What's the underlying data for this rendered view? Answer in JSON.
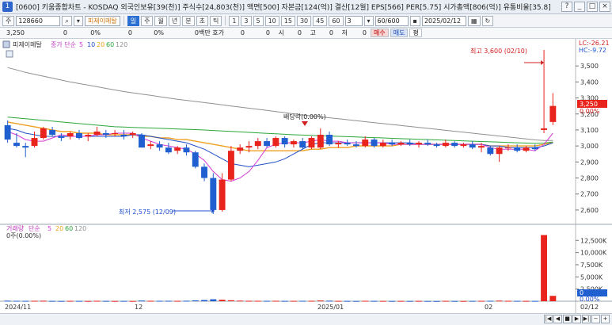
{
  "window": {
    "code": "[0600]",
    "title": "[0600] 키움종합차트 - KOSDAQ 외국인보유[39(천)] 주식수[24,803(천)] 액면[500] 자본금[124(억)] 결산[12월] EPS[566] PER[5.75] 시가총액[806(억)] 유통비율[35.8]",
    "buttons": [
      "?",
      "_",
      "□",
      "×"
    ]
  },
  "toolbar": {
    "period_btn": "주",
    "stock_code": "128660",
    "stock_name": "피제이메탈",
    "modes": [
      "일",
      "주",
      "월",
      "년",
      "분",
      "초",
      "틱"
    ],
    "active_mode": "일",
    "intervals": [
      "1",
      "3",
      "5",
      "10",
      "15",
      "30",
      "45",
      "60"
    ],
    "count_value": "3",
    "range_value": "60/600",
    "date_value": "2025/02/12"
  },
  "quote": {
    "price": "3,250",
    "cells": [
      "0",
      "0%",
      "0",
      "0%",
      "0백만 호가",
      "0",
      "0",
      "시",
      "0",
      "고",
      "0",
      "저",
      "0"
    ],
    "buy_label": "매수",
    "sell_label": "매도",
    "other_label": "평"
  },
  "price_panel": {
    "legend_name": "피제이메탈",
    "legend_ma": "종가 단순",
    "legend_periods": [
      "5",
      "10",
      "20",
      "60",
      "120"
    ],
    "lc_label": "LC:-26.21",
    "hc_label": "HC:-9.72",
    "current_price": "3,250",
    "current_change": "0.00%",
    "high_annotation": "최고 3,600 (02/10)",
    "low_annotation": "최저 2,575 (12/09)",
    "event_annotation": "배당락(0.00%)",
    "y_ticks": [
      "3,500",
      "3,400",
      "3,300",
      "3,200",
      "3,100",
      "3,000",
      "2,900",
      "2,800",
      "2,700",
      "2,600"
    ]
  },
  "volume_panel": {
    "legend_name": "거래량",
    "legend_ma": "단순",
    "legend_periods": [
      "5",
      "20",
      "60",
      "120"
    ],
    "subtitle": "0주(0.00%)",
    "current_value": "0",
    "current_change": "0.00%",
    "y_ticks": [
      "12,500K",
      "10,000K",
      "7,500K",
      "5,000K",
      "2,500K"
    ]
  },
  "x_axis": {
    "labels": [
      "2024/11",
      "12",
      "2025/01",
      "02"
    ],
    "end_label": "02/12"
  },
  "colors": {
    "up": "#e8241c",
    "down": "#1f5fd0",
    "ma5": "#d63cd6",
    "ma10": "#2050c8",
    "ma20": "#f0a020",
    "ma60": "#2aa83a",
    "ma120": "#909090"
  },
  "chart_data": {
    "type": "candlestick",
    "ylim": [
      2550,
      3600
    ],
    "candles": [
      {
        "o": 3130,
        "h": 3160,
        "l": 3020,
        "c": 3040
      },
      {
        "o": 3020,
        "h": 3080,
        "l": 2990,
        "c": 3000
      },
      {
        "o": 3000,
        "h": 3020,
        "l": 2930,
        "c": 2990
      },
      {
        "o": 3000,
        "h": 3090,
        "l": 2990,
        "c": 3050
      },
      {
        "o": 3050,
        "h": 3120,
        "l": 3040,
        "c": 3110
      },
      {
        "o": 3100,
        "h": 3120,
        "l": 3060,
        "c": 3070
      },
      {
        "o": 3060,
        "h": 3080,
        "l": 3030,
        "c": 3050
      },
      {
        "o": 3060,
        "h": 3090,
        "l": 3040,
        "c": 3080
      },
      {
        "o": 3080,
        "h": 3100,
        "l": 3040,
        "c": 3050
      },
      {
        "o": 3060,
        "h": 3080,
        "l": 3030,
        "c": 3070
      },
      {
        "o": 3070,
        "h": 3120,
        "l": 3060,
        "c": 3090
      },
      {
        "o": 3080,
        "h": 3100,
        "l": 3050,
        "c": 3070
      },
      {
        "o": 3080,
        "h": 3100,
        "l": 3060,
        "c": 3080
      },
      {
        "o": 3070,
        "h": 3100,
        "l": 3040,
        "c": 3060
      },
      {
        "o": 3070,
        "h": 3090,
        "l": 3050,
        "c": 3080
      },
      {
        "o": 3070,
        "h": 3080,
        "l": 2990,
        "c": 2990
      },
      {
        "o": 3000,
        "h": 3030,
        "l": 2980,
        "c": 3010
      },
      {
        "o": 3010,
        "h": 3030,
        "l": 2970,
        "c": 2990
      },
      {
        "o": 2990,
        "h": 3020,
        "l": 2950,
        "c": 2960
      },
      {
        "o": 2970,
        "h": 3000,
        "l": 2950,
        "c": 2990
      },
      {
        "o": 2990,
        "h": 3010,
        "l": 2940,
        "c": 2960
      },
      {
        "o": 2960,
        "h": 2970,
        "l": 2860,
        "c": 2870
      },
      {
        "o": 2870,
        "h": 2890,
        "l": 2780,
        "c": 2800
      },
      {
        "o": 2800,
        "h": 2830,
        "l": 2575,
        "c": 2600
      },
      {
        "o": 2600,
        "h": 2830,
        "l": 2590,
        "c": 2790
      },
      {
        "o": 2790,
        "h": 3000,
        "l": 2780,
        "c": 2970
      },
      {
        "o": 2970,
        "h": 3010,
        "l": 2950,
        "c": 2990
      },
      {
        "o": 2990,
        "h": 3030,
        "l": 2960,
        "c": 3000
      },
      {
        "o": 3000,
        "h": 3050,
        "l": 2980,
        "c": 3030
      },
      {
        "o": 3030,
        "h": 3050,
        "l": 2990,
        "c": 3000
      },
      {
        "o": 3000,
        "h": 3060,
        "l": 2990,
        "c": 3050
      },
      {
        "o": 3050,
        "h": 3060,
        "l": 2990,
        "c": 3010
      },
      {
        "o": 3010,
        "h": 3040,
        "l": 2990,
        "c": 3030
      },
      {
        "o": 3030,
        "h": 3050,
        "l": 2980,
        "c": 2990
      },
      {
        "o": 2990,
        "h": 3060,
        "l": 2980,
        "c": 3050
      },
      {
        "o": 2990,
        "h": 3110,
        "l": 2980,
        "c": 3070
      },
      {
        "o": 3070,
        "h": 3090,
        "l": 3000,
        "c": 3010
      },
      {
        "o": 3010,
        "h": 3030,
        "l": 2990,
        "c": 3020
      },
      {
        "o": 3020,
        "h": 3040,
        "l": 3000,
        "c": 3010
      },
      {
        "o": 3010,
        "h": 3030,
        "l": 2990,
        "c": 3000
      },
      {
        "o": 3000,
        "h": 3060,
        "l": 2990,
        "c": 3040
      },
      {
        "o": 3040,
        "h": 3050,
        "l": 2990,
        "c": 3000
      },
      {
        "o": 3000,
        "h": 3040,
        "l": 2990,
        "c": 3020
      },
      {
        "o": 3020,
        "h": 3040,
        "l": 3000,
        "c": 3010
      },
      {
        "o": 3010,
        "h": 3030,
        "l": 3000,
        "c": 3020
      },
      {
        "o": 3020,
        "h": 3040,
        "l": 3000,
        "c": 3010
      },
      {
        "o": 3010,
        "h": 3030,
        "l": 2990,
        "c": 3020
      },
      {
        "o": 3020,
        "h": 3040,
        "l": 3000,
        "c": 3010
      },
      {
        "o": 3010,
        "h": 3020,
        "l": 2990,
        "c": 3000
      },
      {
        "o": 3000,
        "h": 3040,
        "l": 2990,
        "c": 3020
      },
      {
        "o": 3020,
        "h": 3030,
        "l": 2990,
        "c": 3000
      },
      {
        "o": 3000,
        "h": 3020,
        "l": 2990,
        "c": 3010
      },
      {
        "o": 3010,
        "h": 3030,
        "l": 2980,
        "c": 2990
      },
      {
        "o": 2990,
        "h": 3020,
        "l": 2960,
        "c": 3000
      },
      {
        "o": 2990,
        "h": 3000,
        "l": 2940,
        "c": 2950
      },
      {
        "o": 2950,
        "h": 3000,
        "l": 2900,
        "c": 2990
      },
      {
        "o": 2990,
        "h": 3010,
        "l": 2970,
        "c": 2990
      },
      {
        "o": 2990,
        "h": 3010,
        "l": 2960,
        "c": 2970
      },
      {
        "o": 2970,
        "h": 3000,
        "l": 2960,
        "c": 2990
      },
      {
        "o": 2990,
        "h": 3010,
        "l": 2970,
        "c": 2980
      },
      {
        "o": 3100,
        "h": 3600,
        "l": 3080,
        "c": 3110
      },
      {
        "o": 3150,
        "h": 3330,
        "l": 3130,
        "c": 3250
      }
    ],
    "volume": [
      110,
      80,
      70,
      90,
      100,
      60,
      50,
      70,
      60,
      50,
      80,
      60,
      50,
      60,
      50,
      140,
      90,
      80,
      90,
      70,
      100,
      180,
      250,
      400,
      300,
      200,
      120,
      90,
      80,
      70,
      90,
      60,
      70,
      80,
      90,
      150,
      110,
      70,
      60,
      50,
      80,
      60,
      60,
      50,
      60,
      50,
      60,
      50,
      40,
      70,
      50,
      50,
      60,
      70,
      90,
      120,
      80,
      70,
      60,
      60,
      13600,
      1100
    ],
    "ma5": [
      3090,
      3070,
      3040,
      3030,
      3030,
      3050,
      3070,
      3060,
      3060,
      3060,
      3070,
      3070,
      3080,
      3080,
      3080,
      3050,
      3030,
      3010,
      3000,
      2990,
      2980,
      2950,
      2910,
      2840,
      2790,
      2780,
      2800,
      2840,
      2910,
      2990,
      3010,
      3020,
      3020,
      3020,
      3030,
      3040,
      3030,
      3030,
      3020,
      3020,
      3020,
      3020,
      3020,
      3010,
      3010,
      3010,
      3010,
      3010,
      3010,
      3010,
      3010,
      3010,
      3010,
      3010,
      2990,
      2980,
      2980,
      2980,
      2980,
      2970,
      3010,
      3080
    ],
    "ma10": [
      3110,
      3100,
      3080,
      3070,
      3060,
      3060,
      3060,
      3060,
      3060,
      3060,
      3060,
      3060,
      3060,
      3060,
      3070,
      3070,
      3060,
      3050,
      3040,
      3030,
      3020,
      3000,
      2980,
      2950,
      2920,
      2890,
      2880,
      2870,
      2880,
      2890,
      2900,
      2920,
      2950,
      2980,
      3010,
      3020,
      3020,
      3020,
      3020,
      3020,
      3020,
      3020,
      3020,
      3020,
      3020,
      3020,
      3010,
      3010,
      3010,
      3010,
      3010,
      3010,
      3010,
      3010,
      3000,
      3000,
      2990,
      2990,
      2990,
      2990,
      3000,
      3020
    ],
    "ma20": [
      3150,
      3140,
      3130,
      3120,
      3110,
      3100,
      3090,
      3090,
      3080,
      3080,
      3080,
      3070,
      3070,
      3070,
      3070,
      3060,
      3060,
      3050,
      3050,
      3040,
      3040,
      3030,
      3020,
      3010,
      3000,
      2990,
      2980,
      2970,
      2970,
      2970,
      2970,
      2970,
      2970,
      2970,
      2980,
      2980,
      2990,
      2990,
      2990,
      3000,
      3000,
      3000,
      3000,
      3000,
      3010,
      3010,
      3010,
      3010,
      3010,
      3010,
      3010,
      3010,
      3010,
      3010,
      3000,
      3000,
      3000,
      3000,
      3000,
      3000,
      3010,
      3020
    ],
    "ma60": [
      3180,
      3175,
      3170,
      3165,
      3160,
      3155,
      3150,
      3145,
      3140,
      3135,
      3130,
      3125,
      3120,
      3118,
      3116,
      3114,
      3112,
      3110,
      3108,
      3106,
      3104,
      3102,
      3100,
      3097,
      3094,
      3091,
      3088,
      3085,
      3082,
      3079,
      3076,
      3073,
      3070,
      3068,
      3066,
      3064,
      3062,
      3060,
      3058,
      3056,
      3054,
      3052,
      3050,
      3048,
      3046,
      3044,
      3042,
      3040,
      3038,
      3036,
      3034,
      3032,
      3030,
      3028,
      3026,
      3024,
      3022,
      3020,
      3018,
      3016,
      3018,
      3025
    ],
    "ma120": [
      3490,
      3475,
      3460,
      3448,
      3436,
      3424,
      3412,
      3400,
      3390,
      3380,
      3370,
      3360,
      3350,
      3340,
      3332,
      3324,
      3316,
      3308,
      3300,
      3292,
      3285,
      3278,
      3271,
      3264,
      3257,
      3250,
      3243,
      3236,
      3229,
      3222,
      3215,
      3208,
      3201,
      3194,
      3188,
      3182,
      3176,
      3170,
      3164,
      3158,
      3152,
      3146,
      3140,
      3134,
      3128,
      3122,
      3116,
      3110,
      3104,
      3098,
      3092,
      3086,
      3080,
      3074,
      3068,
      3062,
      3056,
      3050,
      3044,
      3038,
      3034,
      3034
    ]
  }
}
